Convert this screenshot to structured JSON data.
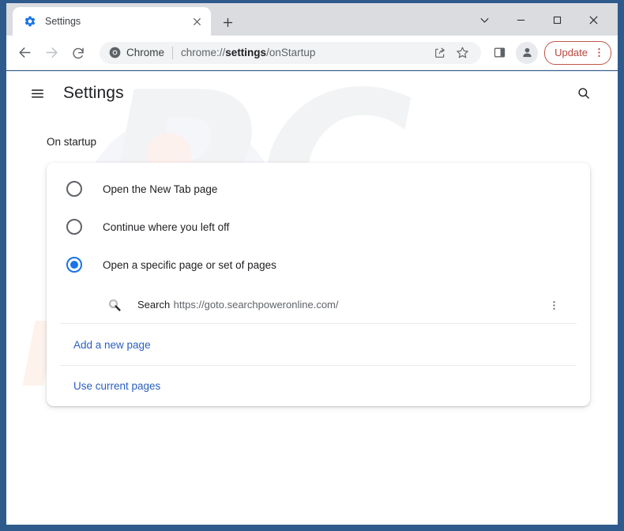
{
  "window": {
    "frame_color": "#2f5a8c",
    "controls": {
      "collapse": "chevron-down",
      "minimize": "minimize",
      "maximize": "maximize",
      "close": "close"
    }
  },
  "tabstrip": {
    "tabs": [
      {
        "title": "Settings",
        "favicon": "gear-icon-blue",
        "close_label": "Close tab"
      }
    ],
    "new_tab_label": "New tab"
  },
  "toolbar": {
    "back_label": "Back",
    "forward_label": "Forward",
    "reload_label": "Reload",
    "omnibox": {
      "chip_icon": "chrome-logo-icon",
      "chip_label": "Chrome",
      "url_prefix": "chrome://",
      "url_bold": "settings",
      "url_suffix": "/onStartup",
      "full_url": "chrome://settings/onStartup",
      "share_label": "Share this page",
      "bookmark_label": "Bookmark this tab"
    },
    "side_panel_label": "Side panel",
    "profile_label": "Profile",
    "update_label": "Update",
    "menu_label": "Customize and control Google Chrome"
  },
  "settings": {
    "menu_label": "Main menu",
    "title": "Settings",
    "search_label": "Search settings",
    "section_label": "On startup",
    "startup_options": [
      {
        "label": "Open the New Tab page",
        "selected": false
      },
      {
        "label": "Continue where you left off",
        "selected": false
      },
      {
        "label": "Open a specific page or set of pages",
        "selected": true
      }
    ],
    "startup_pages": [
      {
        "name": "Search",
        "url": "https://goto.searchpoweronline.com/",
        "favicon": "magnifier-favicon",
        "more_label": "More actions"
      }
    ],
    "add_page_label": "Add a new page",
    "use_current_label": "Use current pages",
    "accent_color": "#1a73e8",
    "link_color": "#2b5fc0"
  },
  "watermark": {
    "primary_text": "PC",
    "secondary_text": "risk.com",
    "primary_color": "#f2f3f4",
    "secondary_color": "#fdf2ec"
  }
}
